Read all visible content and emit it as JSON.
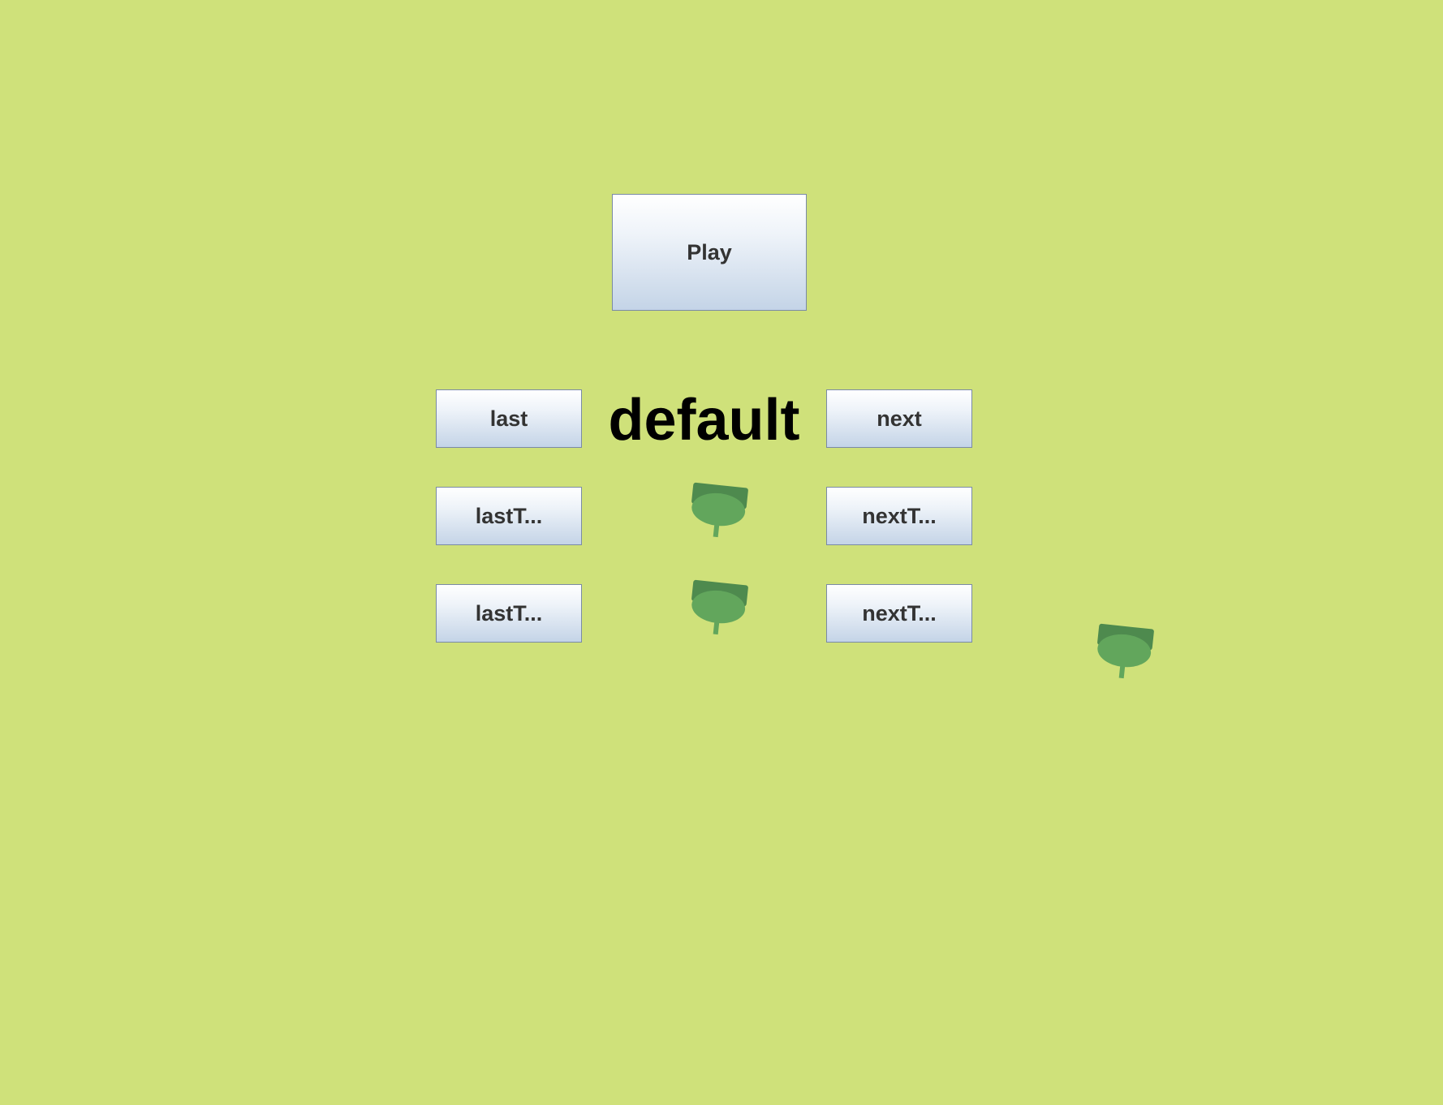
{
  "colors": {
    "background": "#cfe17a",
    "tank_body": "#62a65c",
    "tank_top": "#4e8a4e"
  },
  "menu": {
    "play_label": "Play",
    "last_label": "last",
    "next_label": "next",
    "last_type_1_label": "lastT...",
    "next_type_1_label": "nextT...",
    "last_type_2_label": "lastT...",
    "next_type_2_label": "nextT..."
  },
  "level": {
    "name": "default"
  },
  "sprites": [
    {
      "icon": "tank-icon"
    },
    {
      "icon": "tank-icon"
    },
    {
      "icon": "tank-icon"
    }
  ]
}
